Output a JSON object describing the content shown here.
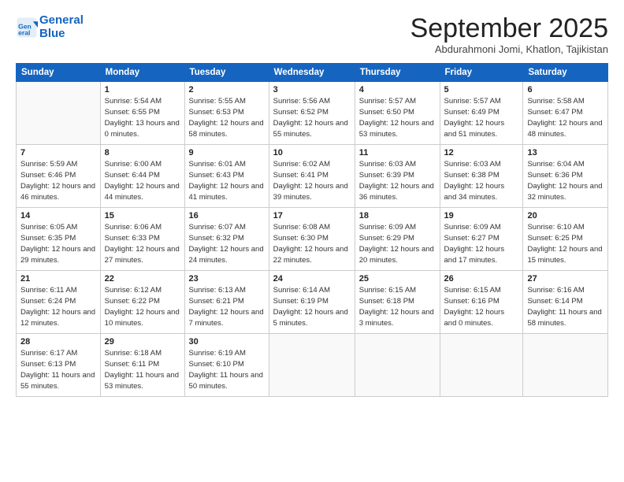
{
  "logo": {
    "line1": "General",
    "line2": "Blue"
  },
  "title": "September 2025",
  "subtitle": "Abdurahmoni Jomi, Khatlon, Tajikistan",
  "weekdays": [
    "Sunday",
    "Monday",
    "Tuesday",
    "Wednesday",
    "Thursday",
    "Friday",
    "Saturday"
  ],
  "weeks": [
    [
      {
        "day": "",
        "info": ""
      },
      {
        "day": "1",
        "info": "Sunrise: 5:54 AM\nSunset: 6:55 PM\nDaylight: 13 hours\nand 0 minutes."
      },
      {
        "day": "2",
        "info": "Sunrise: 5:55 AM\nSunset: 6:53 PM\nDaylight: 12 hours\nand 58 minutes."
      },
      {
        "day": "3",
        "info": "Sunrise: 5:56 AM\nSunset: 6:52 PM\nDaylight: 12 hours\nand 55 minutes."
      },
      {
        "day": "4",
        "info": "Sunrise: 5:57 AM\nSunset: 6:50 PM\nDaylight: 12 hours\nand 53 minutes."
      },
      {
        "day": "5",
        "info": "Sunrise: 5:57 AM\nSunset: 6:49 PM\nDaylight: 12 hours\nand 51 minutes."
      },
      {
        "day": "6",
        "info": "Sunrise: 5:58 AM\nSunset: 6:47 PM\nDaylight: 12 hours\nand 48 minutes."
      }
    ],
    [
      {
        "day": "7",
        "info": "Sunrise: 5:59 AM\nSunset: 6:46 PM\nDaylight: 12 hours\nand 46 minutes."
      },
      {
        "day": "8",
        "info": "Sunrise: 6:00 AM\nSunset: 6:44 PM\nDaylight: 12 hours\nand 44 minutes."
      },
      {
        "day": "9",
        "info": "Sunrise: 6:01 AM\nSunset: 6:43 PM\nDaylight: 12 hours\nand 41 minutes."
      },
      {
        "day": "10",
        "info": "Sunrise: 6:02 AM\nSunset: 6:41 PM\nDaylight: 12 hours\nand 39 minutes."
      },
      {
        "day": "11",
        "info": "Sunrise: 6:03 AM\nSunset: 6:39 PM\nDaylight: 12 hours\nand 36 minutes."
      },
      {
        "day": "12",
        "info": "Sunrise: 6:03 AM\nSunset: 6:38 PM\nDaylight: 12 hours\nand 34 minutes."
      },
      {
        "day": "13",
        "info": "Sunrise: 6:04 AM\nSunset: 6:36 PM\nDaylight: 12 hours\nand 32 minutes."
      }
    ],
    [
      {
        "day": "14",
        "info": "Sunrise: 6:05 AM\nSunset: 6:35 PM\nDaylight: 12 hours\nand 29 minutes."
      },
      {
        "day": "15",
        "info": "Sunrise: 6:06 AM\nSunset: 6:33 PM\nDaylight: 12 hours\nand 27 minutes."
      },
      {
        "day": "16",
        "info": "Sunrise: 6:07 AM\nSunset: 6:32 PM\nDaylight: 12 hours\nand 24 minutes."
      },
      {
        "day": "17",
        "info": "Sunrise: 6:08 AM\nSunset: 6:30 PM\nDaylight: 12 hours\nand 22 minutes."
      },
      {
        "day": "18",
        "info": "Sunrise: 6:09 AM\nSunset: 6:29 PM\nDaylight: 12 hours\nand 20 minutes."
      },
      {
        "day": "19",
        "info": "Sunrise: 6:09 AM\nSunset: 6:27 PM\nDaylight: 12 hours\nand 17 minutes."
      },
      {
        "day": "20",
        "info": "Sunrise: 6:10 AM\nSunset: 6:25 PM\nDaylight: 12 hours\nand 15 minutes."
      }
    ],
    [
      {
        "day": "21",
        "info": "Sunrise: 6:11 AM\nSunset: 6:24 PM\nDaylight: 12 hours\nand 12 minutes."
      },
      {
        "day": "22",
        "info": "Sunrise: 6:12 AM\nSunset: 6:22 PM\nDaylight: 12 hours\nand 10 minutes."
      },
      {
        "day": "23",
        "info": "Sunrise: 6:13 AM\nSunset: 6:21 PM\nDaylight: 12 hours\nand 7 minutes."
      },
      {
        "day": "24",
        "info": "Sunrise: 6:14 AM\nSunset: 6:19 PM\nDaylight: 12 hours\nand 5 minutes."
      },
      {
        "day": "25",
        "info": "Sunrise: 6:15 AM\nSunset: 6:18 PM\nDaylight: 12 hours\nand 3 minutes."
      },
      {
        "day": "26",
        "info": "Sunrise: 6:15 AM\nSunset: 6:16 PM\nDaylight: 12 hours\nand 0 minutes."
      },
      {
        "day": "27",
        "info": "Sunrise: 6:16 AM\nSunset: 6:14 PM\nDaylight: 11 hours\nand 58 minutes."
      }
    ],
    [
      {
        "day": "28",
        "info": "Sunrise: 6:17 AM\nSunset: 6:13 PM\nDaylight: 11 hours\nand 55 minutes."
      },
      {
        "day": "29",
        "info": "Sunrise: 6:18 AM\nSunset: 6:11 PM\nDaylight: 11 hours\nand 53 minutes."
      },
      {
        "day": "30",
        "info": "Sunrise: 6:19 AM\nSunset: 6:10 PM\nDaylight: 11 hours\nand 50 minutes."
      },
      {
        "day": "",
        "info": ""
      },
      {
        "day": "",
        "info": ""
      },
      {
        "day": "",
        "info": ""
      },
      {
        "day": "",
        "info": ""
      }
    ]
  ]
}
